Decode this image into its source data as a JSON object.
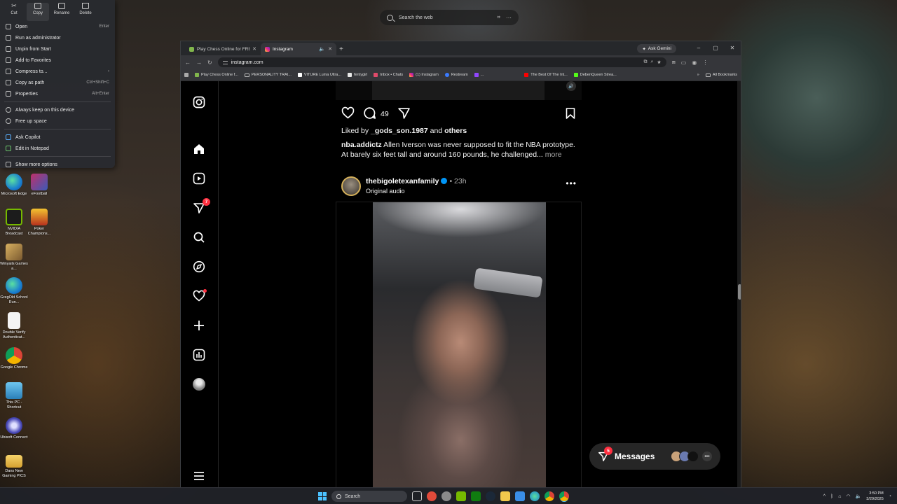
{
  "web_search": {
    "placeholder": "Search the web"
  },
  "context_menu": {
    "toolbar": [
      {
        "label": "Cut"
      },
      {
        "label": "Copy"
      },
      {
        "label": "Rename"
      },
      {
        "label": "Delete"
      }
    ],
    "items": [
      {
        "label": "Open",
        "shortcut": "Enter"
      },
      {
        "label": "Run as administrator",
        "shortcut": ""
      },
      {
        "label": "Unpin from Start",
        "shortcut": ""
      },
      {
        "label": "Add to Favorites",
        "shortcut": ""
      },
      {
        "label": "Compress to...",
        "shortcut": "›"
      },
      {
        "label": "Copy as path",
        "shortcut": "Ctrl+Shift+C"
      },
      {
        "label": "Properties",
        "shortcut": "Alt+Enter"
      },
      {
        "label": "Always keep on this device",
        "shortcut": ""
      },
      {
        "label": "Free up space",
        "shortcut": ""
      },
      {
        "label": "Ask Copilot",
        "shortcut": ""
      },
      {
        "label": "Edit in Notepad",
        "shortcut": ""
      },
      {
        "label": "Show more options",
        "shortcut": ""
      }
    ]
  },
  "desktop_icons": [
    {
      "label": "Microsoft Edge"
    },
    {
      "label": "eFootball"
    },
    {
      "label": "NVIDIA Broadcast"
    },
    {
      "label": "Poker Champions..."
    },
    {
      "label": "Winyails Games a..."
    },
    {
      "label": "GregOld School Run..."
    },
    {
      "label": "Double Verify Authenticat..."
    },
    {
      "label": "Google Chrome"
    },
    {
      "label": "This PC - Shortcut"
    },
    {
      "label": "Ubisoft Connect"
    },
    {
      "label": "Dans New Gaming PICS"
    }
  ],
  "browser": {
    "tabs": [
      {
        "title": "Play Chess Online for FREE - 2...",
        "active": false
      },
      {
        "title": "Instagram",
        "active": true
      }
    ],
    "ask_gemini": "Ask Gemini",
    "url": "instagram.com",
    "bookmarks": [
      {
        "label": "Play Chess Online f..."
      },
      {
        "label": "PERSONALITY TRAI..."
      },
      {
        "label": "VITURE Luma Ultra..."
      },
      {
        "label": "fentygirl"
      },
      {
        "label": "Inbox • Chats"
      },
      {
        "label": "(1) Instagram"
      },
      {
        "label": "Restream"
      },
      {
        "label": "..."
      },
      {
        "label": "The Best Of The Int..."
      },
      {
        "label": "DebenQueen Strea..."
      }
    ],
    "all_bookmarks": "All Bookmarks"
  },
  "instagram": {
    "nav": [
      {
        "icon": "instagram-logo-icon"
      },
      {
        "icon": "home-icon"
      },
      {
        "icon": "reels-icon"
      },
      {
        "icon": "direct-icon",
        "badge": "7"
      },
      {
        "icon": "search-icon"
      },
      {
        "icon": "explore-icon"
      },
      {
        "icon": "notifications-heart-icon"
      },
      {
        "icon": "create-icon"
      },
      {
        "icon": "dashboard-icon"
      },
      {
        "icon": "profile-icon"
      },
      {
        "icon": "menu-icon"
      },
      {
        "icon": "also-from-meta-icon"
      }
    ],
    "prev_post": {
      "comment_count": "49",
      "liked_by_prefix": "Liked by",
      "liked_by_user": "_gods_son.1987",
      "liked_by_and": "and",
      "liked_by_others": "others",
      "caption_user": "nba.addictz",
      "caption_text": "Allen Iverson was never supposed to fit the NBA prototype. At barely six feet tall and around 160 pounds, he challenged...",
      "more": "more"
    },
    "post": {
      "username": "thebigoletexanfamily",
      "time": "• 23h",
      "audio": "Original audio"
    },
    "messages": {
      "label": "Messages",
      "badge": "5"
    }
  },
  "taskbar": {
    "search_placeholder": "Search",
    "time": "3:50 PM",
    "date": "3/29/2025"
  }
}
